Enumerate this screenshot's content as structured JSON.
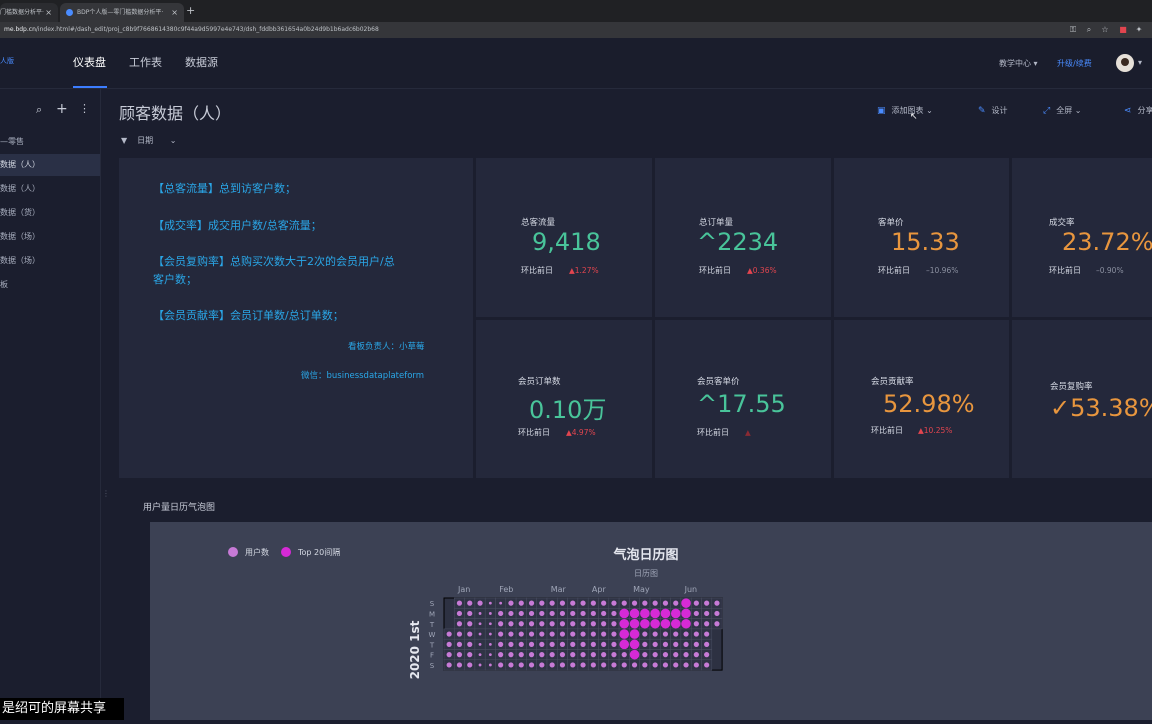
{
  "browser": {
    "tabs": [
      {
        "label": "门槛数据分析平·",
        "active": false
      },
      {
        "label": "BDP个人版—零门槛数据分析平·",
        "active": true
      }
    ],
    "url_host": "me.bdp.cn",
    "url_path": "/index.html#/dash_edit/proj_c8b9f7668614380c9f44a9d5997e4e743/dsh_fddbb361654a0b24d9b1b6adc6b02b68"
  },
  "header": {
    "logo_fragment": "人版",
    "nav": [
      {
        "label": "仪表盘",
        "active": true
      },
      {
        "label": "工作表",
        "active": false
      },
      {
        "label": "数据源",
        "active": false
      }
    ],
    "teach_center": "教学中心",
    "upgrade": "升级/续费"
  },
  "sidebar": {
    "group_label": "—零售",
    "items": [
      {
        "label": "数据（人）",
        "active": true
      },
      {
        "label": "数据（人）",
        "active": false
      },
      {
        "label": "数据（货）",
        "active": false
      },
      {
        "label": "数据（场）",
        "active": false
      },
      {
        "label": "数据（场）",
        "active": false
      },
      {
        "label": "板",
        "active": false
      }
    ]
  },
  "page": {
    "title": "顾客数据（人）",
    "toolbar": {
      "add_chart": "添加图表",
      "design": "设计",
      "fullscreen": "全屏",
      "share": "分享"
    },
    "filter": {
      "label": "日期"
    }
  },
  "notes": {
    "lines": [
      "【总客流量】总到访客户数；",
      "【成交率】成交用户数/总客流量；",
      "【会员复购率】总购买次数大于2次的会员用户/总",
      "客户数；",
      "【会员贡献率】会员订单数/总订单数；"
    ],
    "owner": "看板负责人：小草莓",
    "wechat": "微信：businessdataplateform"
  },
  "kpis": [
    {
      "label": "总客流量",
      "value": "9,418",
      "prefix": "",
      "compare": "环比前日",
      "change": "1.27%",
      "dir": "up",
      "color": "#49c49a"
    },
    {
      "label": "总订单量",
      "value": "2234",
      "prefix": "^",
      "compare": "环比前日",
      "change": "0.36%",
      "dir": "up",
      "color": "#49c49a"
    },
    {
      "label": "客单价",
      "value": "15.33",
      "prefix": "",
      "compare": "环比前日",
      "change": "10.96%",
      "dir": "down",
      "color": "#e8963e"
    },
    {
      "label": "成交率",
      "value": "23.72%",
      "prefix": "",
      "compare": "环比前日",
      "change": "0.90%",
      "dir": "down",
      "color": "#e8963e"
    },
    {
      "label": "会员订单数",
      "value": "0.10万",
      "prefix": "",
      "compare": "环比前日",
      "change": "4.97%",
      "dir": "up",
      "color": "#49c49a"
    },
    {
      "label": "会员客单价",
      "value": "17.55",
      "prefix": "^",
      "compare": "环比前日",
      "change": "",
      "dir": "up",
      "color": "#49c49a"
    },
    {
      "label": "会员贡献率",
      "value": "52.98%",
      "prefix": "",
      "compare": "环比前日",
      "change": "10.25%",
      "dir": "up",
      "color": "#e8963e"
    },
    {
      "label": "会员复购率",
      "value": "53.38%",
      "prefix": "✓",
      "compare": "",
      "change": "",
      "dir": "up",
      "color": "#e8963e"
    }
  ],
  "bubble_section": {
    "title": "用户量日历气泡图"
  },
  "chart_data": {
    "type": "heatmap",
    "title": "气泡日历图",
    "subtitle": "日历图",
    "legend": [
      {
        "name": "用户数",
        "color": "#c77ad6"
      },
      {
        "name": "Top 20间隔",
        "color": "#d62ad6"
      }
    ],
    "year_label": "2020 1st",
    "months": [
      "Jan",
      "Feb",
      "Mar",
      "Apr",
      "May",
      "Jun"
    ],
    "weekdays": [
      "S",
      "M",
      "T",
      "W",
      "T",
      "F",
      "S"
    ],
    "highlight_days": [
      "04-27",
      "04-28",
      "04-29",
      "04-30",
      "05-04",
      "05-05",
      "05-06",
      "05-07",
      "05-08",
      "05-11",
      "05-12",
      "05-18",
      "05-19",
      "05-25",
      "05-26",
      "06-01",
      "06-02",
      "06-07",
      "06-08",
      "06-09"
    ]
  },
  "screen_share_caption": "是绍可的屏幕共享"
}
